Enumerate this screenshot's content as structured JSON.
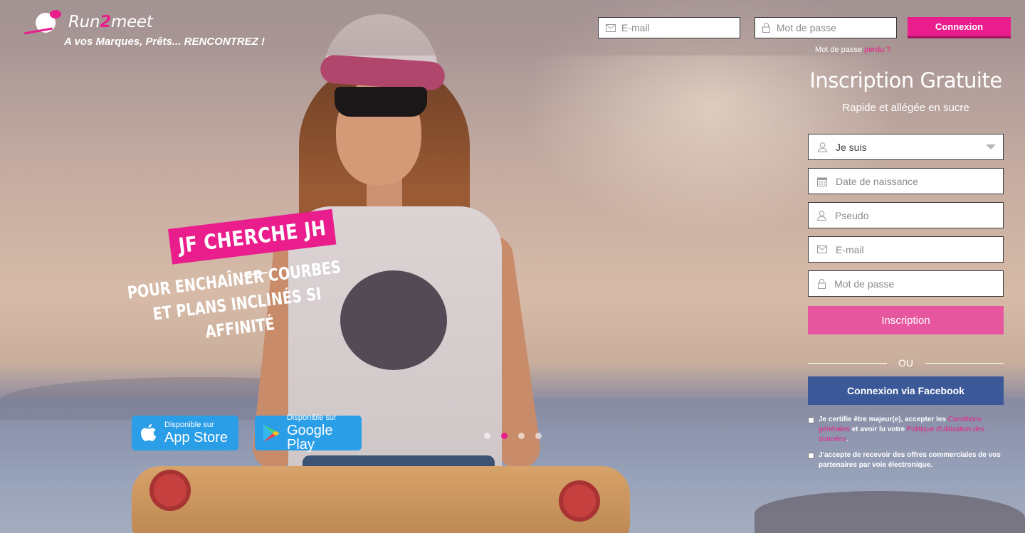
{
  "brand": {
    "name_prefix": "Run",
    "name_accent": "2",
    "name_suffix": "meet",
    "tagline": "A vos Marques, Prêts... RENCONTREZ !",
    "accent_color": "#e91e8c"
  },
  "login": {
    "email_placeholder": "E-mail",
    "password_placeholder": "Mot de passe",
    "button_label": "Connexion",
    "forgot_prefix": "Mot de passe",
    "forgot_link": "perdu ?"
  },
  "hero": {
    "badge": "JF CHERCHE JH",
    "subtitle": "POUR ENCHAÎNER COURBES ET PLANS INCLINÉS SI AFFINITÉ"
  },
  "stores": {
    "apple": {
      "small": "Disponible sur",
      "big": "App Store",
      "icon": "apple-icon"
    },
    "google": {
      "small": "Disponible sur",
      "big": "Google Play",
      "icon": "google-play-icon"
    },
    "color": "#2b9ee8"
  },
  "carousel": {
    "slide_count": 4,
    "active_index": 1
  },
  "register": {
    "title": "Inscription Gratuite",
    "subtitle": "Rapide et allégée en sucre",
    "gender_select": "Je suis",
    "birthdate_placeholder": "Date de naissance",
    "pseudo_placeholder": "Pseudo",
    "email_placeholder": "E-mail",
    "password_placeholder": "Mot de passe",
    "submit_label": "Inscription",
    "or_label": "OU",
    "facebook_label": "Connexion via Facebook",
    "facebook_color": "#3b5998",
    "terms_part1": "Je certifie être majeur(e), accepter les",
    "terms_link1": "Conditions générales",
    "terms_part2": "et avoir lu votre",
    "terms_link2": "Politique d'utilisation des données",
    "terms_end": ".",
    "offers_text": "J'accepte de recevoir des offres commerciales de vos partenaires par voie électronique."
  }
}
